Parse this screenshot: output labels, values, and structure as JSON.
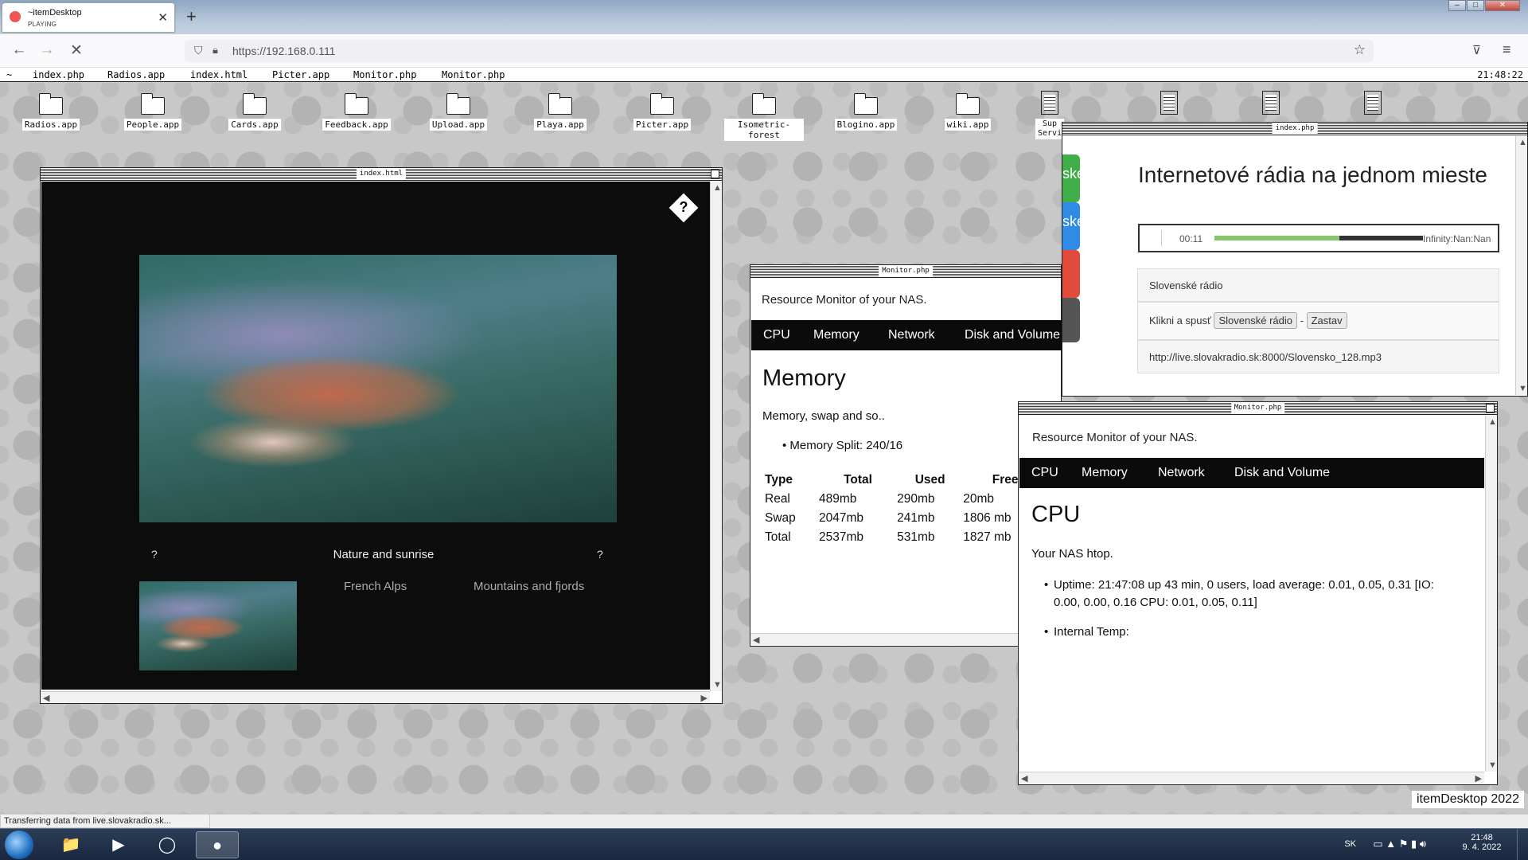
{
  "browser": {
    "tab_title": "~itemDesktop",
    "tab_status": "PLAYING",
    "new_tab_icon": "+",
    "url": "https://192.168.0.111",
    "status_text": "Transferring data from live.slovakradio.sk..."
  },
  "menubar": {
    "home": "~",
    "items": [
      "index.php",
      "Radios.app",
      "index.html",
      "Picter.app",
      "Monitor.php",
      "Monitor.php"
    ],
    "clock": "21:48:22"
  },
  "desktop_icons": [
    {
      "label": "Radios.app",
      "icon": "folder-icon"
    },
    {
      "label": "People.app",
      "icon": "folder-icon"
    },
    {
      "label": "Cards.app",
      "icon": "folder-icon"
    },
    {
      "label": "Feedback.app",
      "icon": "folder-icon"
    },
    {
      "label": "Upload.app",
      "icon": "folder-icon"
    },
    {
      "label": "Playa.app",
      "icon": "folder-icon"
    },
    {
      "label": "Picter.app",
      "icon": "folder-icon"
    },
    {
      "label": "Isometric-forest",
      "icon": "folder-icon"
    },
    {
      "label": "Blogino.app",
      "icon": "folder-icon"
    },
    {
      "label": "wiki.app",
      "icon": "folder-icon"
    },
    {
      "label": "Sup Servi",
      "icon": "document-icon"
    }
  ],
  "gallery_window": {
    "title": "index.html",
    "help_icon": "?",
    "prev": "?",
    "caption": "Nature and sunrise",
    "next": "?",
    "albums": [
      "French Alps",
      "Mountains and fjords"
    ]
  },
  "monitor_window_1": {
    "title": "Monitor.php",
    "header": "Resource Monitor of your NAS.",
    "tabs": [
      "CPU",
      "Memory",
      "Network",
      "Disk and Volume"
    ],
    "section_title": "Memory",
    "subtitle": "Memory, swap and so..",
    "split": "Memory Split: 240/16",
    "table": {
      "headers": [
        "Type",
        "Total",
        "Used",
        "Free"
      ],
      "rows": [
        [
          "Real",
          "489mb",
          "290mb",
          "20mb"
        ],
        [
          "Swap",
          "2047mb",
          "241mb",
          "1806 mb"
        ],
        [
          "Total",
          "2537mb",
          "531mb",
          "1827 mb"
        ]
      ]
    }
  },
  "monitor_window_2": {
    "title": "Monitor.php",
    "header": "Resource Monitor of your NAS.",
    "tabs": [
      "CPU",
      "Memory",
      "Network",
      "Disk and Volume"
    ],
    "section_title": "CPU",
    "subtitle": "Your NAS htop.",
    "uptime": "Uptime: 21:47:08 up 43 min, 0 users, load average: 0.01, 0.05, 0.31 [IO: 0.00, 0.00, 0.16 CPU: 0.01, 0.05, 0.11]",
    "temp": "Internal Temp:"
  },
  "radio_window": {
    "title": "index.php",
    "heading": "Internetové rádia na jednom mieste",
    "player_time": "00:11",
    "player_progress": 0.6,
    "player_meta": "Infinity:Nan:Nan",
    "side_tabs": [
      {
        "text": "ské",
        "color": "#3fae49"
      },
      {
        "text": "ske",
        "color": "#2f8be6"
      },
      {
        "text": "",
        "color": "#e24a3b"
      },
      {
        "text": "",
        "color": "#555555"
      }
    ],
    "station_name": "Slovenské rádio",
    "play_prompt": "Klikni a spusť",
    "play_button": "Slovenské rádio",
    "separator": "-",
    "stop_button": "Zastav",
    "stream_url": "http://live.slovakradio.sk:8000/Slovensko_128.mp3"
  },
  "footer": {
    "credit": "itemDesktop 2022"
  },
  "taskbar": {
    "lang": "SK",
    "time": "21:48",
    "date": "9. 4. 2022"
  }
}
